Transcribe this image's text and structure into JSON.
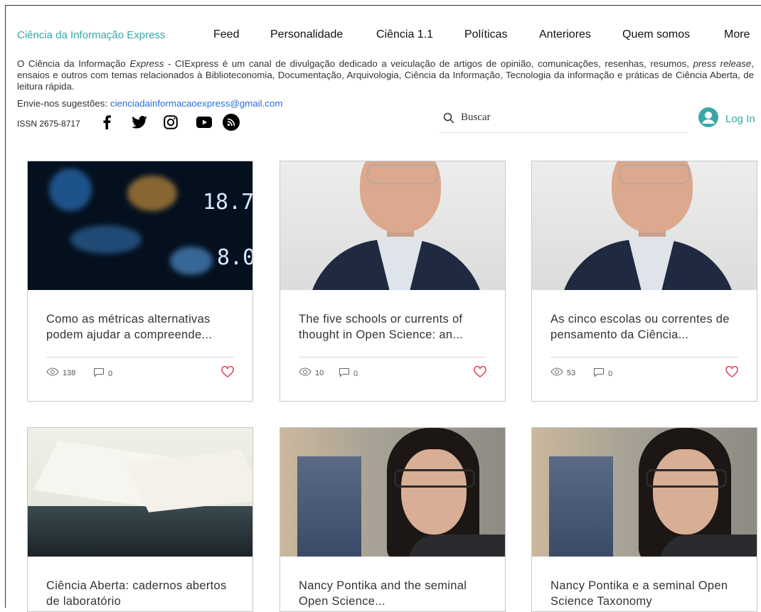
{
  "nav": {
    "brand": "Ciência da Informação Express",
    "items": [
      "Feed",
      "Personalidade",
      "Ciência 1.1",
      "Políticas",
      "Anteriores",
      "Quem somos",
      "More"
    ]
  },
  "intro": {
    "part1": "O Ciência da Informação ",
    "express": "Express",
    "part2": " - CIExpress é um canal de divulgação dedicado a veiculação de artigos de opinião, comunicações, resenhas, resumos, ",
    "press_release": "press release",
    "part3": ", ensaios e outros com temas relacionados à Biblioteconomia, Documentação, Arquivologia, Ciência da Informação, Tecnologia da informação e práticas de Ciência Aberta, de leitura rápida.",
    "suggestions_label": "Envie-nos sugestões: ",
    "email": "cienciadainformacaoexpress@gmail.com"
  },
  "issn": "ISSN 2675-8717",
  "social": [
    "facebook-icon",
    "twitter-icon",
    "instagram-icon",
    "youtube-icon",
    "rss-icon"
  ],
  "search": {
    "placeholder": "Buscar"
  },
  "login": {
    "label": "Log In"
  },
  "accent_color": "#3aa7a7",
  "posts": [
    {
      "title": "Como as métricas alternativas podem ajudar a compreende...",
      "views": "138",
      "comments": "0",
      "image": "stock-board"
    },
    {
      "title": "The five schools or currents of thought in Open Science: an...",
      "views": "10",
      "comments": "0",
      "image": "portrait-man"
    },
    {
      "title": "As cinco escolas ou correntes de pensamento da Ciência...",
      "views": "53",
      "comments": "0",
      "image": "portrait-man"
    },
    {
      "title": "Ciência Aberta: cadernos abertos de laboratório",
      "image": "open-book"
    },
    {
      "title": "Nancy Pontika and the seminal Open Science...",
      "image": "portrait-woman"
    },
    {
      "title": "Nancy Pontika e a seminal Open Science Taxonomy",
      "image": "portrait-woman"
    }
  ]
}
